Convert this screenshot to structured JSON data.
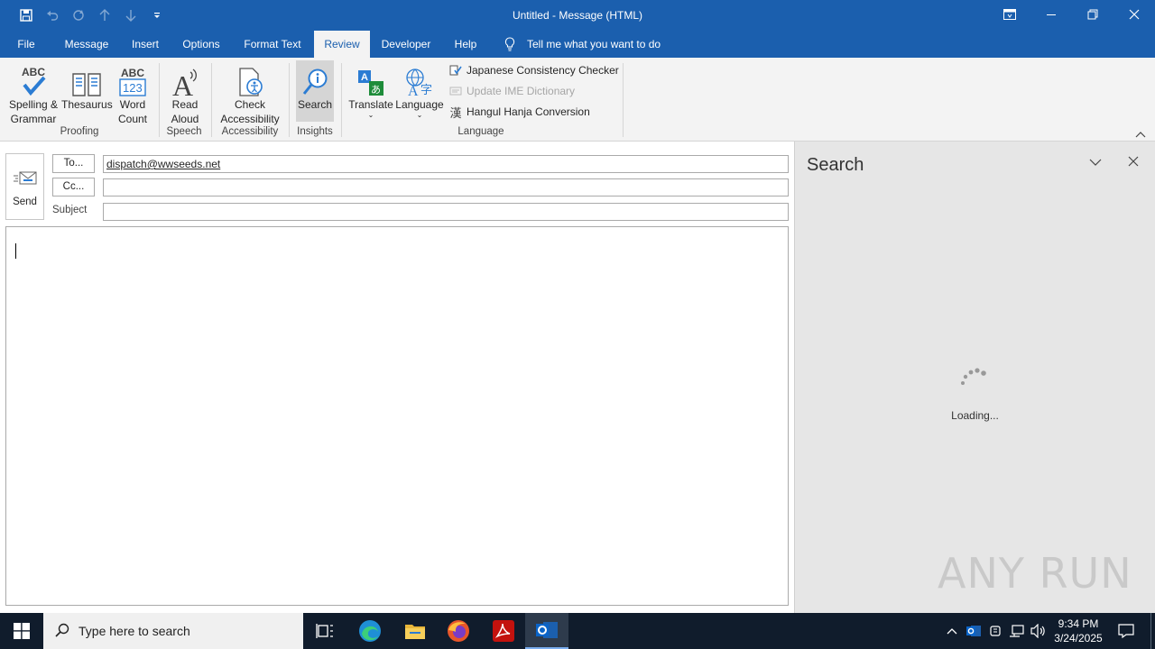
{
  "window": {
    "title": "Untitled  -  Message (HTML)"
  },
  "menu": {
    "tabs": [
      "File",
      "Message",
      "Insert",
      "Options",
      "Format Text",
      "Review",
      "Developer",
      "Help"
    ],
    "active": "Review",
    "tell_me": "Tell me what you want to do"
  },
  "ribbon": {
    "spelling": "Spelling &\nGrammar",
    "spelling_l1": "Spelling &",
    "spelling_l2": "Grammar",
    "thesaurus": "Thesaurus",
    "word_count_l1": "Word",
    "word_count_l2": "Count",
    "read_aloud_l1": "Read",
    "read_aloud_l2": "Aloud",
    "check_l1": "Check",
    "check_l2": "Accessibility",
    "search": "Search",
    "translate": "Translate",
    "language": "Language",
    "japanese": "Japanese Consistency Checker",
    "update_ime": "Update IME Dictionary",
    "hangul": "Hangul Hanja Conversion",
    "groups": {
      "proofing": "Proofing",
      "speech": "Speech",
      "accessibility": "Accessibility",
      "insights": "Insights",
      "language": "Language"
    }
  },
  "compose": {
    "send": "Send",
    "to_label": "To...",
    "cc_label": "Cc...",
    "subject_label": "Subject",
    "to_value": "dispatch@wwseeds.net",
    "cc_value": "",
    "subject_value": ""
  },
  "pane": {
    "title": "Search",
    "loading": "Loading..."
  },
  "watermark": "ANY RUN",
  "taskbar": {
    "search_placeholder": "Type here to search",
    "time": "9:34 PM",
    "date": "3/24/2025"
  },
  "colors": {
    "accent": "#1b5fae",
    "taskbar": "#101c2c"
  }
}
